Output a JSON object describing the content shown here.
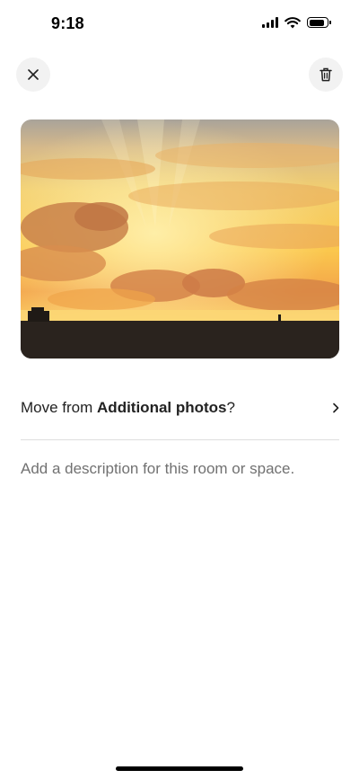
{
  "status_bar": {
    "time": "9:18",
    "icons": [
      "cellular-signal-icon",
      "wifi-icon",
      "battery-icon"
    ]
  },
  "header": {
    "close_icon": "close-icon",
    "delete_icon": "trash-icon"
  },
  "photo": {
    "subject": "sunset-photo"
  },
  "move_row": {
    "prefix": "Move from ",
    "album": "Additional photos",
    "suffix": "?",
    "chevron_icon": "chevron-right-icon"
  },
  "description": {
    "placeholder": "Add a description for this room or space."
  },
  "colors": {
    "text_primary": "#222222",
    "text_secondary": "#717171",
    "button_bg": "#f2f2f2",
    "divider": "#dddddd"
  }
}
